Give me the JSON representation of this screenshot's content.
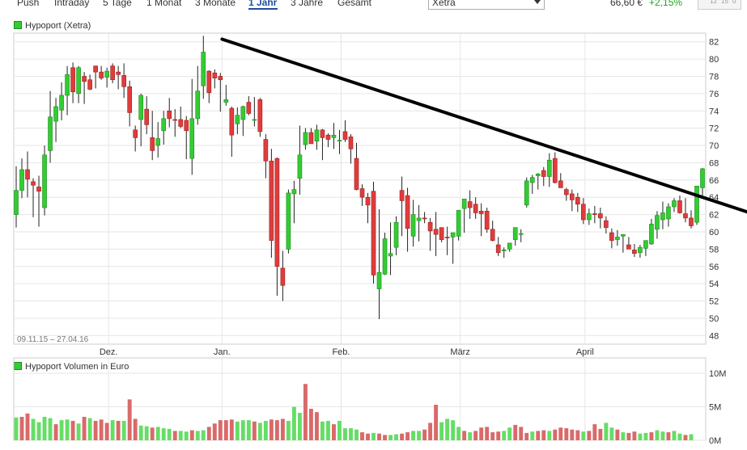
{
  "toolbar": {
    "tabs": [
      "Push",
      "Intraday",
      "5 Tage",
      "1 Monat",
      "3 Monate",
      "1 Jahr",
      "3 Jahre",
      "Gesamt"
    ],
    "active_tab": "1 Jahr",
    "exchange_select": "Xetra",
    "price": "66,60 €",
    "change": "+2,15%",
    "mini_ticks": [
      "12",
      "15",
      "0"
    ]
  },
  "colors": {
    "up": "#33cc33",
    "down": "#e03c3c",
    "grid": "#e6e6e6",
    "trendline": "#000000",
    "volume_up": "#66dd66",
    "volume_down": "#d96a6a"
  },
  "chart_data": [
    {
      "type": "candlestick",
      "legend": "Hypoport (Xetra)",
      "date_range_label": "09.11.15 – 27.04.16",
      "x_tick_labels": [
        "Dez.",
        "Jan.",
        "Feb.",
        "März",
        "April"
      ],
      "y_ticks": [
        48,
        50,
        52,
        54,
        56,
        58,
        60,
        62,
        64,
        66,
        68,
        70,
        72,
        74,
        76,
        78,
        80,
        82
      ],
      "ylim": [
        47,
        83
      ],
      "trendline": {
        "from": {
          "date": "2015-12-30",
          "value": 82.3
        },
        "to": {
          "date": "2016-04-30",
          "value": 62.5
        }
      },
      "ohlc": [
        [
          62.0,
          67.6,
          60.5,
          64.8
        ],
        [
          64.8,
          68.5,
          63.9,
          67.2
        ],
        [
          67.2,
          69.3,
          64.0,
          66.1
        ],
        [
          65.8,
          66.2,
          61.7,
          65.4
        ],
        [
          65.2,
          66.5,
          60.6,
          64.7
        ],
        [
          62.8,
          70.0,
          61.9,
          68.9
        ],
        [
          69.4,
          76.3,
          68.0,
          73.3
        ],
        [
          72.8,
          75.5,
          70.4,
          74.5
        ],
        [
          74.1,
          77.3,
          72.9,
          75.8
        ],
        [
          75.8,
          79.2,
          73.5,
          78.2
        ],
        [
          79.0,
          79.6,
          74.9,
          76.2
        ],
        [
          76.0,
          79.2,
          74.9,
          79.0
        ],
        [
          78.0,
          78.5,
          74.8,
          77.4
        ],
        [
          77.6,
          78.2,
          76.4,
          76.5
        ],
        [
          79.2,
          79.2,
          76.6,
          78.5
        ],
        [
          78.5,
          79.2,
          77.6,
          77.8
        ],
        [
          77.9,
          79.0,
          76.7,
          78.6
        ],
        [
          79.2,
          79.5,
          77.2,
          77.6
        ],
        [
          78.5,
          79.2,
          76.5,
          78.2
        ],
        [
          78.1,
          79.5,
          75.5,
          76.8
        ],
        [
          76.8,
          77.5,
          72.2,
          73.8
        ],
        [
          71.8,
          72.3,
          69.3,
          70.9
        ],
        [
          73.0,
          76.0,
          69.9,
          75.8
        ],
        [
          74.2,
          75.7,
          71.3,
          72.4
        ],
        [
          70.9,
          74.0,
          68.3,
          69.4
        ],
        [
          70.0,
          72.7,
          68.6,
          70.8
        ],
        [
          71.7,
          74.0,
          70.1,
          73.1
        ],
        [
          74.0,
          75.5,
          72.1,
          73.1
        ],
        [
          73.0,
          74.2,
          71.0,
          72.9
        ],
        [
          73.0,
          74.5,
          72.0,
          72.2
        ],
        [
          72.9,
          73.4,
          68.4,
          71.7
        ],
        [
          68.5,
          77.7,
          66.6,
          73.1
        ],
        [
          73.1,
          79.2,
          72.4,
          76.3
        ],
        [
          76.9,
          82.7,
          75.4,
          80.8
        ],
        [
          78.6,
          78.7,
          74.9,
          76.1
        ],
        [
          78.4,
          78.8,
          76.6,
          77.8
        ],
        [
          78.0,
          78.4,
          73.9,
          77.6
        ],
        [
          75.0,
          77.0,
          74.6,
          75.3
        ],
        [
          74.3,
          74.5,
          68.7,
          71.2
        ],
        [
          72.5,
          74.4,
          71.3,
          73.5
        ],
        [
          73.0,
          74.6,
          71.1,
          74.5
        ],
        [
          75.0,
          75.7,
          73.5,
          73.7
        ],
        [
          73.0,
          75.6,
          72.2,
          73.0
        ],
        [
          75.3,
          75.5,
          71.0,
          71.6
        ],
        [
          70.7,
          71.3,
          66.2,
          68.2
        ],
        [
          68.2,
          69.6,
          57.0,
          59.0
        ],
        [
          68.5,
          68.6,
          52.6,
          56.0
        ],
        [
          55.8,
          57.8,
          52.0,
          53.8
        ],
        [
          58.0,
          64.9,
          57.5,
          64.5
        ],
        [
          64.4,
          65.9,
          61.0,
          64.9
        ],
        [
          66.2,
          72.3,
          64.3,
          68.9
        ],
        [
          70.1,
          72.0,
          69.5,
          71.5
        ],
        [
          71.5,
          72.0,
          70.5,
          70.2
        ],
        [
          70.5,
          72.4,
          69.5,
          71.8
        ],
        [
          71.8,
          71.9,
          68.3,
          70.9
        ],
        [
          71.2,
          71.4,
          69.8,
          70.7
        ],
        [
          70.9,
          72.6,
          69.6,
          71.2
        ],
        [
          70.6,
          71.8,
          69.0,
          70.6
        ],
        [
          71.6,
          72.9,
          70.4,
          70.7
        ],
        [
          71.0,
          71.3,
          67.9,
          69.6
        ],
        [
          68.5,
          70.3,
          64.8,
          64.9
        ],
        [
          65.0,
          65.5,
          63.0,
          64.0
        ],
        [
          64.0,
          64.5,
          61.0,
          63.1
        ],
        [
          64.7,
          65.8,
          54.0,
          55.0
        ],
        [
          53.4,
          62.6,
          49.9,
          55.3
        ],
        [
          55.1,
          59.9,
          55.0,
          59.2
        ],
        [
          57.2,
          61.1,
          55.0,
          57.5
        ],
        [
          58.2,
          61.8,
          57.3,
          61.1
        ],
        [
          64.8,
          66.4,
          59.5,
          63.6
        ],
        [
          64.2,
          65.1,
          57.7,
          60.4
        ],
        [
          59.5,
          63.7,
          58.3,
          62.0
        ],
        [
          61.3,
          63.1,
          58.9,
          61.6
        ],
        [
          61.6,
          62.3,
          61.0,
          61.5
        ],
        [
          61.1,
          61.6,
          57.8,
          60.1
        ],
        [
          60.3,
          62.3,
          57.2,
          59.7
        ],
        [
          60.5,
          60.5,
          58.8,
          59.1
        ],
        [
          59.4,
          60.6,
          57.3,
          59.3
        ],
        [
          59.4,
          59.9,
          56.3,
          59.9
        ],
        [
          59.5,
          62.5,
          59.0,
          62.5
        ],
        [
          62.7,
          63.5,
          59.9,
          63.8
        ],
        [
          63.5,
          64.8,
          61.5,
          62.8
        ],
        [
          63.2,
          64.0,
          61.5,
          62.2
        ],
        [
          62.4,
          63.3,
          59.5,
          62.1
        ],
        [
          62.4,
          62.8,
          59.9,
          60.3
        ],
        [
          60.3,
          61.3,
          58.9,
          59.0
        ],
        [
          58.5,
          59.4,
          57.2,
          57.6
        ],
        [
          57.8,
          58.2,
          57.0,
          57.9
        ],
        [
          58.0,
          58.5,
          57.7,
          58.7
        ],
        [
          59.1,
          60.1,
          58.4,
          60.5
        ],
        [
          59.7,
          60.3,
          58.8,
          59.8
        ],
        [
          63.1,
          66.3,
          62.8,
          65.9
        ],
        [
          65.7,
          66.6,
          64.4,
          66.3
        ],
        [
          66.5,
          66.8,
          64.9,
          66.7
        ],
        [
          67.1,
          67.5,
          65.3,
          66.4
        ],
        [
          66.4,
          69.1,
          65.2,
          68.3
        ],
        [
          68.5,
          69.2,
          65.6,
          65.7
        ],
        [
          65.9,
          66.8,
          65.1,
          65.1
        ],
        [
          64.9,
          65.1,
          63.6,
          64.3
        ],
        [
          64.4,
          64.9,
          62.4,
          63.7
        ],
        [
          64.0,
          64.5,
          62.3,
          63.2
        ],
        [
          63.2,
          63.9,
          60.9,
          61.4
        ],
        [
          61.4,
          62.7,
          60.8,
          62.1
        ],
        [
          62.1,
          63.0,
          61.0,
          62.0
        ],
        [
          62.1,
          62.8,
          60.4,
          61.6
        ],
        [
          61.3,
          61.8,
          59.8,
          60.5
        ],
        [
          59.9,
          60.4,
          58.1,
          59.0
        ],
        [
          59.1,
          60.2,
          58.4,
          59.4
        ],
        [
          59.5,
          59.7,
          57.6,
          59.7
        ],
        [
          58.5,
          59.4,
          58.1,
          58.0
        ],
        [
          57.9,
          58.6,
          57.1,
          57.5
        ],
        [
          57.6,
          58.5,
          57.0,
          58.2
        ],
        [
          58.1,
          58.7,
          57.2,
          59.0
        ],
        [
          58.6,
          61.5,
          58.5,
          60.9
        ],
        [
          60.3,
          62.4,
          59.2,
          61.9
        ],
        [
          61.4,
          63.5,
          60.3,
          62.2
        ],
        [
          61.5,
          63.3,
          60.6,
          62.9
        ],
        [
          62.9,
          63.9,
          62.3,
          63.6
        ],
        [
          63.6,
          64.2,
          62.1,
          62.2
        ],
        [
          62.1,
          63.9,
          61.1,
          61.6
        ],
        [
          61.6,
          62.5,
          60.4,
          60.7
        ],
        [
          61.1,
          65.2,
          60.8,
          65.3
        ],
        [
          65.1,
          67.4,
          64.2,
          67.3
        ]
      ]
    },
    {
      "type": "bar",
      "legend": "Hypoport Volumen in Euro",
      "y_ticks": [
        "0M",
        "5M",
        "10M"
      ],
      "ylim": [
        0,
        10
      ],
      "values": [
        3.4,
        3.5,
        4.0,
        3.2,
        2.7,
        3.5,
        3.3,
        2.4,
        3.0,
        3.1,
        2.9,
        2.5,
        3.5,
        3.3,
        2.9,
        3.1,
        2.6,
        3.0,
        2.9,
        2.9,
        6.1,
        3.2,
        2.2,
        2.1,
        1.9,
        2.0,
        1.8,
        1.7,
        1.4,
        1.4,
        1.3,
        1.5,
        1.4,
        1.5,
        2.0,
        2.5,
        3.0,
        3.0,
        3.1,
        2.8,
        3.0,
        3.0,
        2.8,
        2.6,
        2.9,
        3.1,
        3.0,
        3.2,
        2.9,
        5.0,
        4.1,
        8.4,
        4.7,
        4.2,
        2.8,
        2.9,
        2.4,
        2.9,
        1.8,
        1.8,
        1.6,
        1.2,
        1.0,
        1.1,
        1.0,
        0.8,
        0.8,
        0.9,
        1.0,
        1.2,
        1.4,
        1.4,
        1.6,
        2.6,
        5.3,
        2.7,
        3.2,
        3.0,
        2.0,
        1.4,
        1.2,
        1.4,
        1.9,
        2.0,
        1.2,
        1.3,
        1.4,
        1.9,
        2.3,
        2.0,
        1.1,
        1.3,
        1.4,
        1.5,
        1.4,
        1.6,
        1.9,
        1.8,
        1.6,
        1.5,
        1.3,
        1.4,
        2.4,
        1.7,
        2.6,
        1.9,
        1.6,
        1.2,
        1.1,
        1.3,
        1.0,
        1.1,
        1.2,
        1.5,
        1.3,
        1.2,
        1.4,
        1.0,
        0.8,
        0.9
      ],
      "up": [
        1,
        0,
        0,
        1,
        1,
        1,
        1,
        0,
        1,
        1,
        0,
        1,
        0,
        1,
        0,
        0,
        0,
        1,
        0,
        1,
        0,
        0,
        1,
        1,
        0,
        1,
        1,
        1,
        0,
        1,
        1,
        0,
        1,
        1,
        0,
        0,
        0,
        0,
        0,
        1,
        1,
        1,
        0,
        1,
        1,
        0,
        0,
        0,
        1,
        1,
        1,
        0,
        0,
        0,
        1,
        1,
        0,
        1,
        1,
        1,
        1,
        0,
        0,
        1,
        0,
        0,
        1,
        1,
        0,
        0,
        1,
        1,
        0,
        0,
        0,
        1,
        1,
        1,
        1,
        0,
        1,
        0,
        0,
        0,
        0,
        0,
        1,
        1,
        0,
        0,
        0,
        1,
        0,
        0,
        1,
        0,
        0,
        0,
        0,
        0,
        1,
        0,
        0,
        0,
        1,
        1,
        0,
        1,
        0,
        0,
        1,
        1,
        0,
        1,
        1,
        0,
        1,
        1,
        0,
        1
      ]
    }
  ]
}
